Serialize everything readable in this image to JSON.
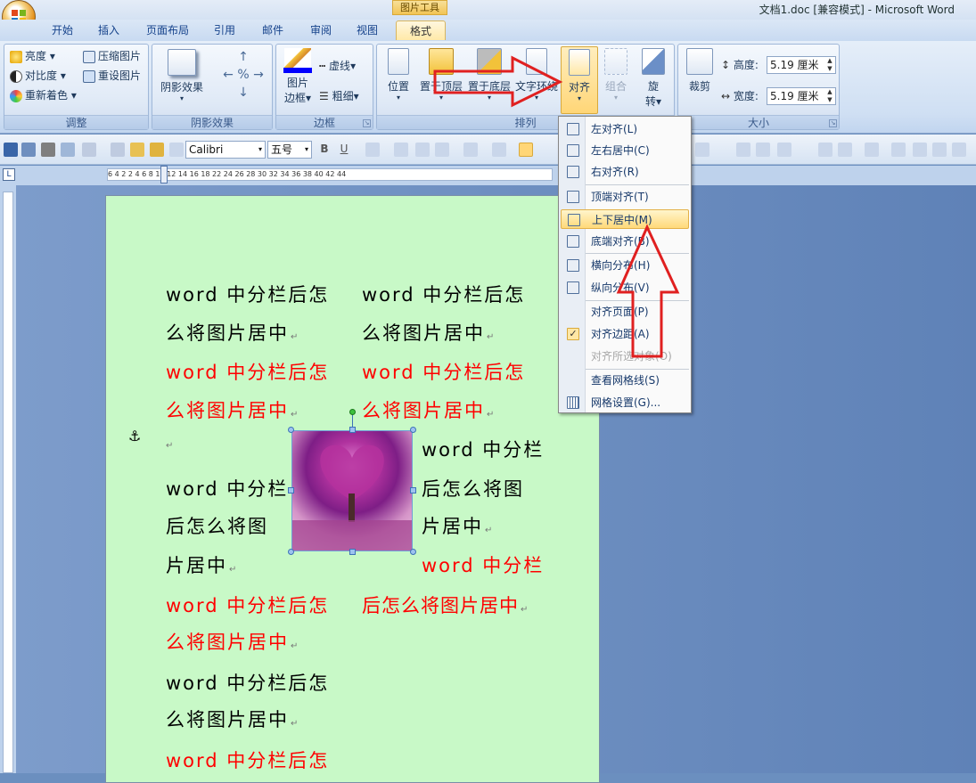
{
  "window": {
    "title": "文档1.doc [兼容模式] - Microsoft Word",
    "context_group": "图片工具"
  },
  "tabs": [
    "开始",
    "插入",
    "页面布局",
    "引用",
    "邮件",
    "审阅",
    "视图",
    "格式"
  ],
  "active_tab": "格式",
  "ribbon": {
    "adjust": {
      "label": "调整",
      "brightness": "亮度",
      "contrast": "对比度",
      "recolor": "重新着色",
      "compress": "压缩图片",
      "reset": "重设图片"
    },
    "shadow": {
      "label": "阴影效果",
      "shadow_btn": "阴影效果"
    },
    "border": {
      "label": "边框",
      "picture_border_1": "图片",
      "picture_border_2": "边框",
      "dash": "虚线",
      "weight": "粗细"
    },
    "arrange": {
      "label": "排列",
      "position": "位置",
      "bring_front": "置于顶层",
      "send_back": "置于底层",
      "text_wrap": "文字环绕",
      "align": "对齐",
      "group": "组合",
      "rotate_1": "旋",
      "rotate_2": "转"
    },
    "size": {
      "label": "大小",
      "crop": "裁剪",
      "height_label": "高度:",
      "height_value": "5.19 厘米",
      "width_label": "宽度:",
      "width_value": "5.19 厘米"
    }
  },
  "toolbar": {
    "font": "Calibri",
    "size": "五号"
  },
  "ruler": {
    "text": "6 4 2 2 4 6 8 10 12 14 16 18 22 24 26 28 30 32 34 36 38 40 42 44"
  },
  "document": {
    "lines": [
      {
        "text": "word 中分栏后怎",
        "color": "black"
      },
      {
        "text": "么将图片居中",
        "color": "black"
      },
      {
        "text": "word 中分栏后怎",
        "color": "red"
      },
      {
        "text": "么将图片居中",
        "color": "red"
      },
      {
        "text": "word 中分栏",
        "color": "black"
      },
      {
        "text": "后怎么将图",
        "color": "black"
      },
      {
        "text": "片居中",
        "color": "black"
      },
      {
        "text": "word 中分栏后怎",
        "color": "red"
      },
      {
        "text": "么将图片居中",
        "color": "red"
      },
      {
        "text": "word 中分栏后怎",
        "color": "black"
      },
      {
        "text": "么将图片居中",
        "color": "black"
      },
      {
        "text": "word 中分栏后怎",
        "color": "red"
      }
    ],
    "right_lines": [
      {
        "text": "word 中分栏后怎",
        "color": "black"
      },
      {
        "text": "么将图片居中",
        "color": "black"
      },
      {
        "text": "word 中分栏后怎",
        "color": "red"
      },
      {
        "text": "么将图片居中",
        "color": "red"
      },
      {
        "text": "word 中分栏",
        "color": "black"
      },
      {
        "text": "后怎么将图",
        "color": "black"
      },
      {
        "text": "片居中",
        "color": "black"
      },
      {
        "text": "word 中分栏",
        "color": "red"
      },
      {
        "text": "后怎么将图片居中",
        "color": "red"
      }
    ],
    "para_mark": "↵",
    "anchor": "⚓"
  },
  "align_menu": {
    "items": [
      {
        "label": "左对齐(L)",
        "enabled": true,
        "highlighted": false
      },
      {
        "label": "左右居中(C)",
        "enabled": true,
        "highlighted": false
      },
      {
        "label": "右对齐(R)",
        "enabled": true,
        "highlighted": false
      },
      {
        "label": "顶端对齐(T)",
        "enabled": true,
        "highlighted": false
      },
      {
        "label": "上下居中(M)",
        "enabled": true,
        "highlighted": true
      },
      {
        "label": "底端对齐(B)",
        "enabled": true,
        "highlighted": false
      },
      {
        "label": "横向分布(H)",
        "enabled": true,
        "highlighted": false
      },
      {
        "label": "纵向分布(V)",
        "enabled": true,
        "highlighted": false
      },
      {
        "label": "对齐页面(P)",
        "enabled": true,
        "highlighted": false
      },
      {
        "label": "对齐边距(A)",
        "enabled": true,
        "checked": true
      },
      {
        "label": "对齐所选对象(O)",
        "enabled": false
      },
      {
        "label": "查看网格线(S)",
        "enabled": true
      },
      {
        "label": "网格设置(G)...",
        "enabled": true
      }
    ]
  },
  "colors": {
    "page": "#c8f9c7",
    "annotation_arrow": "#e02020",
    "highlight": "#ffd97a"
  }
}
